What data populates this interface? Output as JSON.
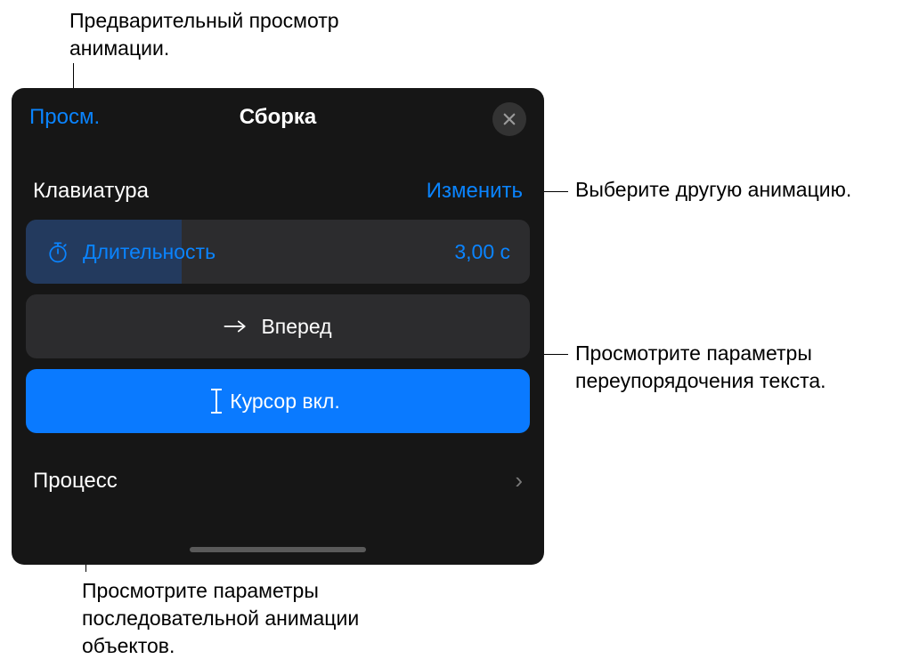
{
  "callouts": {
    "preview": "Предварительный просмотр анимации.",
    "change": "Выберите другую анимацию.",
    "forward": "Просмотрите параметры переупорядочения текста.",
    "process": "Просмотрите параметры последовательной анимации объектов."
  },
  "panel": {
    "preview_label": "Просм.",
    "title": "Сборка",
    "section_title": "Клавиатура",
    "change_label": "Изменить",
    "duration_label": "Длительность",
    "duration_value": "3,00 с",
    "forward_label": "Вперед",
    "cursor_label": "Курсор вкл.",
    "process_label": "Процесс"
  }
}
